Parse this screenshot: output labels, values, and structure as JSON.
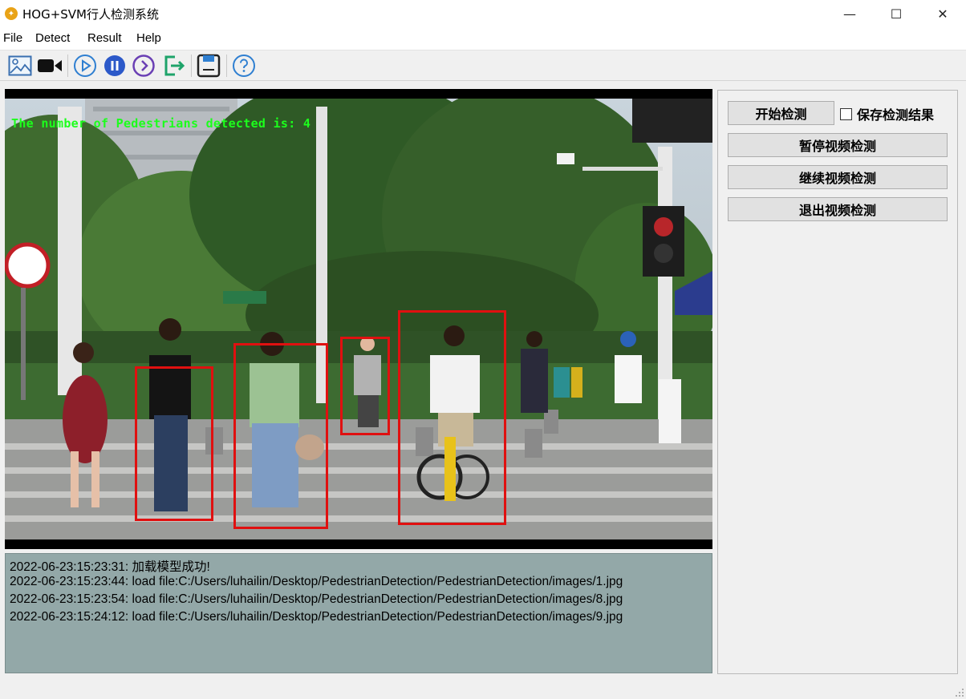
{
  "window": {
    "title": "HOG+SVM行人检测系统",
    "minimize_glyph": "—",
    "maximize_glyph": "☐",
    "close_glyph": "✕"
  },
  "menu": {
    "items": [
      "File",
      "Detect",
      "Result",
      "Help"
    ]
  },
  "toolbar": {
    "icons": [
      "open-image-icon",
      "video-camera-icon",
      "play-icon",
      "pause-icon",
      "resume-icon",
      "exit-icon",
      "save-icon",
      "help-icon"
    ]
  },
  "viewer": {
    "overlay_text": "The number of Pedestrians detected is: 4",
    "detections": 4
  },
  "log": {
    "lines": [
      "2022-06-23:15:23:31:  加载模型成功!",
      "2022-06-23:15:23:44:  load file:C:/Users/luhailin/Desktop/PedestrianDetection/PedestrianDetection/images/1.jpg",
      "2022-06-23:15:23:54:  load file:C:/Users/luhailin/Desktop/PedestrianDetection/PedestrianDetection/images/8.jpg",
      "2022-06-23:15:24:12:  load file:C:/Users/luhailin/Desktop/PedestrianDetection/PedestrianDetection/images/9.jpg"
    ]
  },
  "panel": {
    "start_label": "开始检测",
    "save_checkbox_label": "保存检测结果",
    "save_checked": false,
    "pause_label": "暂停视频检测",
    "continue_label": "继续视频检测",
    "exit_label": "退出视频检测"
  },
  "colors": {
    "detection_box": "#e01010",
    "overlay_text": "#1cff1c",
    "log_background": "#93a8a8"
  }
}
